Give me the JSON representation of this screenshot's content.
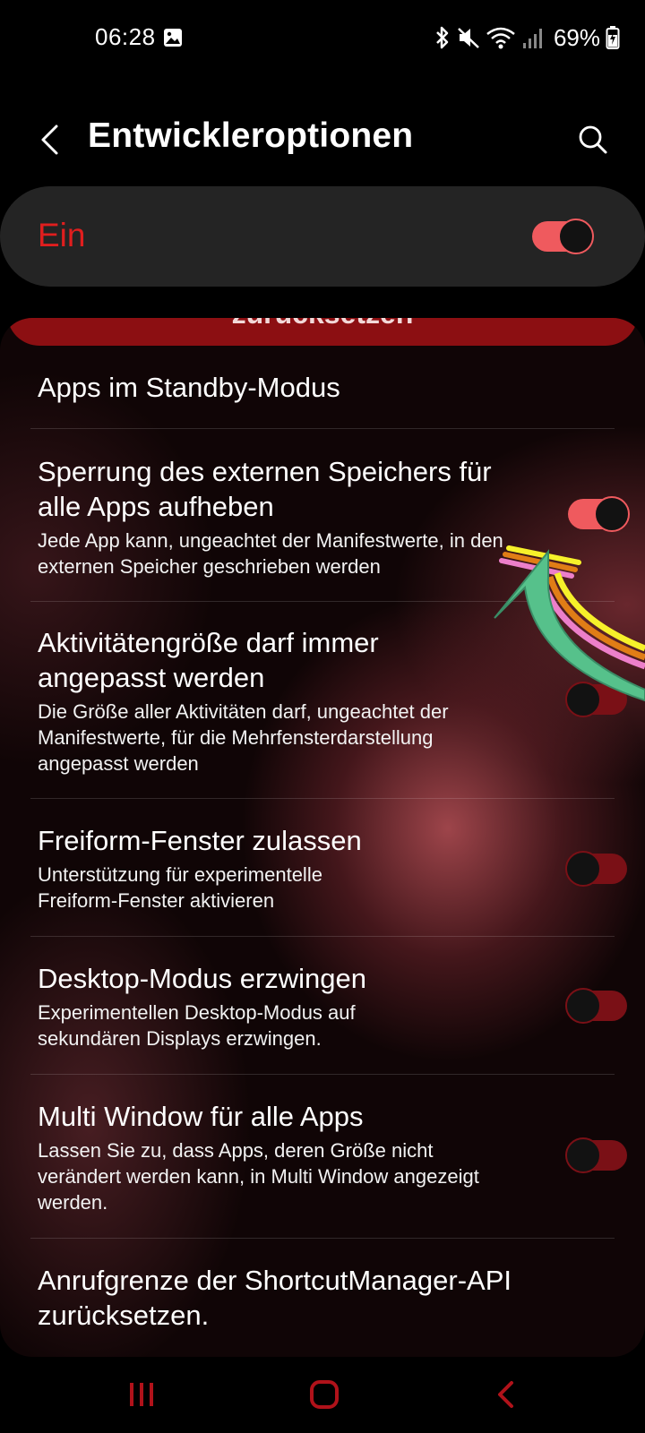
{
  "status_bar": {
    "time": "06:28",
    "battery": "69%",
    "icons": [
      "photo-icon",
      "bluetooth-icon",
      "mute-icon",
      "wifi-icon",
      "signal-icon",
      "battery-icon"
    ]
  },
  "app_bar": {
    "title": "Entwickleroptionen",
    "back_icon": "chevron-left-icon",
    "search_icon": "search-icon"
  },
  "master_switch": {
    "label": "Ein",
    "on": true
  },
  "list": {
    "partial_button": "zurücksetzen",
    "items": [
      {
        "title": "Apps im Standby-Modus",
        "description": ""
      },
      {
        "title": "Sperrung des externen Speichers für alle Apps aufheben",
        "description": "Jede App kann, ungeachtet der Manifestwerte, in den externen Speicher geschrieben werden",
        "on": true
      },
      {
        "title": "Aktivitätengröße darf immer angepasst werden",
        "description": "Die Größe aller Aktivitäten darf, ungeachtet der Manifestwerte, für die Mehrfensterdarstellung angepasst werden",
        "on": false
      },
      {
        "title": "Freiform-Fenster zulassen",
        "description": "Unterstützung für experimentelle Freiform-Fenster aktivieren",
        "on": false
      },
      {
        "title": "Desktop-Modus erzwingen",
        "description": "Experimentellen Desktop-Modus auf sekundären Displays erzwingen.",
        "on": false
      },
      {
        "title": "Multi Window für alle Apps",
        "description": "Lassen Sie zu, dass Apps, deren Größe nicht verändert werden kann, in Multi Window angezeigt werden.",
        "on": false
      },
      {
        "title": "Anrufgrenze der ShortcutManager-API zurücksetzen.",
        "description": ""
      }
    ]
  },
  "colors": {
    "accent_red": "#e01e1e",
    "toggle_on": "#ef5a5e",
    "toggle_off": "#7a1016",
    "card_bg": "#242424",
    "nav_red": "#b0121a"
  },
  "nav_bar": {
    "icons": [
      "recent-apps-icon",
      "home-icon",
      "back-icon"
    ]
  }
}
